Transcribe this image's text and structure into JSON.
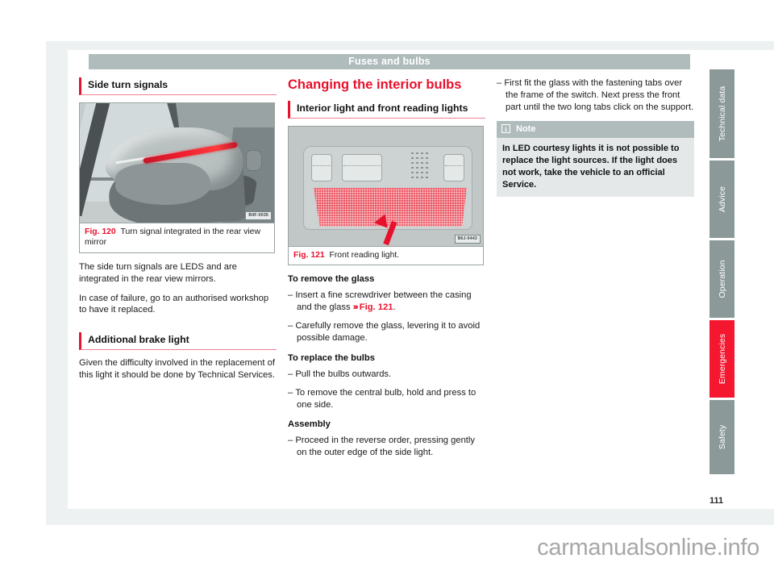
{
  "header": {
    "running_title": "Fuses and bulbs"
  },
  "page": {
    "number": "111",
    "watermark": "carmanualsonline.info"
  },
  "col1": {
    "heading": "Side turn signals",
    "figure": {
      "label": "Fig. 120",
      "caption": "Turn signal integrated in the rear view mirror",
      "code": "B4F-0035",
      "name": "side-mirror-turn-signal-illustration"
    },
    "para1": "The side turn signals are LEDS and are integrated in the rear view mirrors.",
    "para2": "In case of failure, go to an authorised workshop to have it replaced.",
    "heading2": "Additional brake light",
    "para3": "Given the difficulty involved in the replacement of this light it should be done by Technical Services."
  },
  "col2": {
    "section_title": "Changing the interior bulbs",
    "heading": "Interior light and front reading lights",
    "figure": {
      "label": "Fig. 121",
      "caption": "Front reading light.",
      "code": "B6J-0443",
      "name": "front-reading-light-illustration"
    },
    "sub1": "To remove the glass",
    "item1_a": "Insert a fine screwdriver between the casing and the glass ",
    "item1_chevron": "›››",
    "item1_xref": "Fig. 121",
    "item1_end": ".",
    "item2": "Carefully remove the glass, levering it to avoid possible damage.",
    "sub2": "To replace the bulbs",
    "item3": "Pull the bulbs outwards.",
    "item4": "To remove the central bulb, hold and press to one side.",
    "sub3": "Assembly",
    "item5": "Proceed in the reverse order, pressing gently on the outer edge of the side light.",
    "dash": "–"
  },
  "col3": {
    "item1": "First fit the glass with the fastening tabs over the frame of the switch. Next press the front part until the two long tabs click on the support.",
    "dash": "–",
    "note": {
      "icon": "i",
      "title": "Note",
      "body": "In LED courtesy lights it is not possible to replace the light sources. If the light does not work, take the vehicle to an official Service."
    }
  },
  "tabs": [
    {
      "label": "Technical data",
      "active": false,
      "height": 110
    },
    {
      "label": "Advice",
      "active": false,
      "height": 96
    },
    {
      "label": "Operation",
      "active": false,
      "height": 96
    },
    {
      "label": "Emergencies",
      "active": true,
      "height": 96
    },
    {
      "label": "Safety",
      "active": false,
      "height": 92
    }
  ],
  "colors": {
    "accent_red": "#e8112d",
    "tab_active_red": "#f5172f",
    "header_band": "#b0bcbc",
    "tab_grey": "#8c9999",
    "note_body_bg": "#e4e8e8",
    "page_bg": "#eef1f2"
  }
}
